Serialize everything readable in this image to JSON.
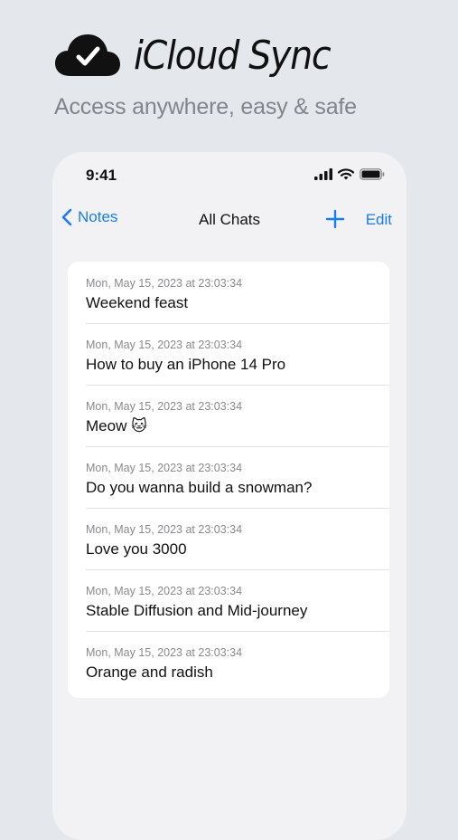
{
  "hero": {
    "icon": "cloud-check-icon",
    "title": "iCloud Sync",
    "subtitle": "Access anywhere,  easy & safe"
  },
  "status_bar": {
    "time": "9:41",
    "icons": [
      "signal-icon",
      "wifi-icon",
      "battery-icon"
    ]
  },
  "navbar": {
    "back_label": "Notes",
    "title": "All Chats",
    "add_icon": "plus-icon",
    "edit_label": "Edit"
  },
  "chats": [
    {
      "date": "Mon, May 15, 2023 at 23:03:34",
      "title": "Weekend feast"
    },
    {
      "date": "Mon, May 15, 2023 at 23:03:34",
      "title": "How to buy an iPhone 14 Pro"
    },
    {
      "date": "Mon, May 15, 2023 at 23:03:34",
      "title": "Meow 🐱"
    },
    {
      "date": "Mon, May 15, 2023 at 23:03:34",
      "title": "Do you wanna build a snowman?"
    },
    {
      "date": "Mon, May 15, 2023 at 23:03:34",
      "title": "Love you 3000"
    },
    {
      "date": "Mon, May 15, 2023 at 23:03:34",
      "title": "Stable Diffusion and Mid-journey"
    },
    {
      "date": "Mon, May 15, 2023 at 23:03:34",
      "title": "Orange and radish"
    }
  ],
  "colors": {
    "accent": "#1a7cf3",
    "background": "#e4e8ec",
    "phone_background": "#f2f2f4"
  }
}
